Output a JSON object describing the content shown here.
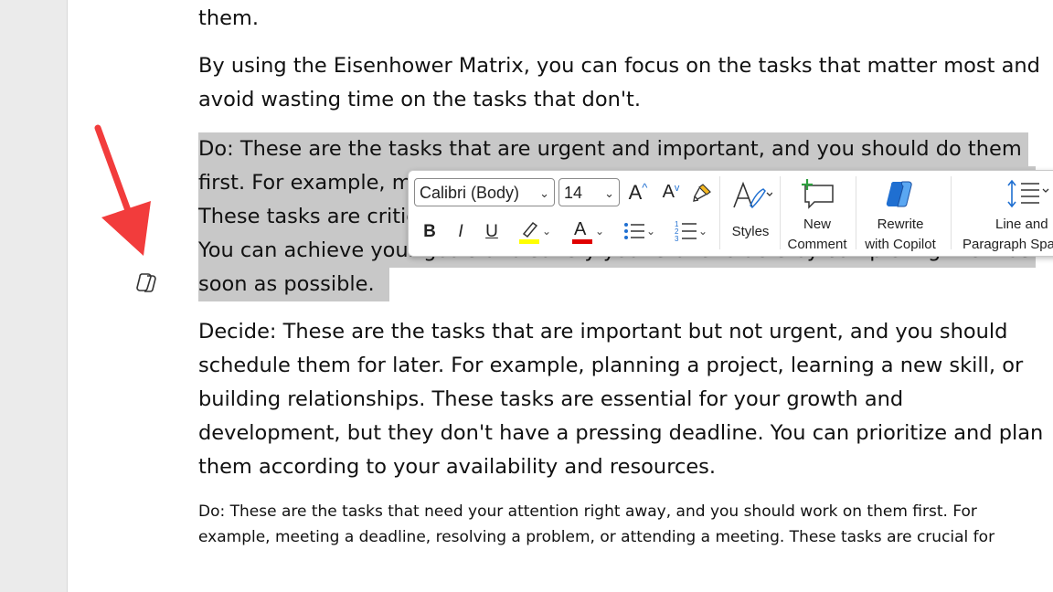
{
  "document": {
    "line_top": "them.",
    "para1": [
      "By using the Eisenhower Matrix, you can focus on the tasks that matter most and",
      "avoid wasting time on the tasks that don't."
    ],
    "selected_para": [
      "Do: These are the tasks that are urgent and important, and you should do them",
      "first. For example, m",
      "These tasks are critic",
      "You can achieve your goals and satisfy your stakeholders by completing them as",
      "soon as possible."
    ],
    "para3": [
      "Decide: These are the tasks that are important but not urgent, and you should",
      "schedule them for later. For example, planning a project, learning a new skill, or",
      "building relationships. These tasks are essential for your growth and",
      "development, but they don't have a pressing deadline. You can prioritize and plan",
      "them according to your availability and resources."
    ],
    "para4": [
      "Do: These are the tasks that need your attention right away, and you should work on them first. For",
      "example, meeting a deadline, resolving a problem, or attending a meeting. These tasks are crucial for"
    ]
  },
  "toolbar": {
    "font_name": "Calibri (Body)",
    "font_size": "14",
    "grow_font": "A",
    "shrink_font": "A",
    "bold": "B",
    "italic": "I",
    "underline": "U",
    "font_color_glyph": "A",
    "styles_label": "Styles",
    "new_comment_label": [
      "New",
      "Comment"
    ],
    "rewrite_label": [
      "Rewrite",
      "with Copilot"
    ],
    "line_spacing_label": [
      "Line and",
      "Paragraph Spa"
    ],
    "highlight_color": "#ffff00",
    "font_color": "#e00000"
  },
  "colors": {
    "selection": "#c8c8c8",
    "arrow": "#f23c3c",
    "accent_blue": "#1f6fd1",
    "comment_green": "#2e9e3e"
  },
  "icons": [
    "copilot-margin-icon",
    "format-painter-icon",
    "styles-icon",
    "new-comment-icon",
    "copilot-icon",
    "line-spacing-icon",
    "bullets-icon",
    "numbering-icon",
    "highlighter-icon"
  ]
}
